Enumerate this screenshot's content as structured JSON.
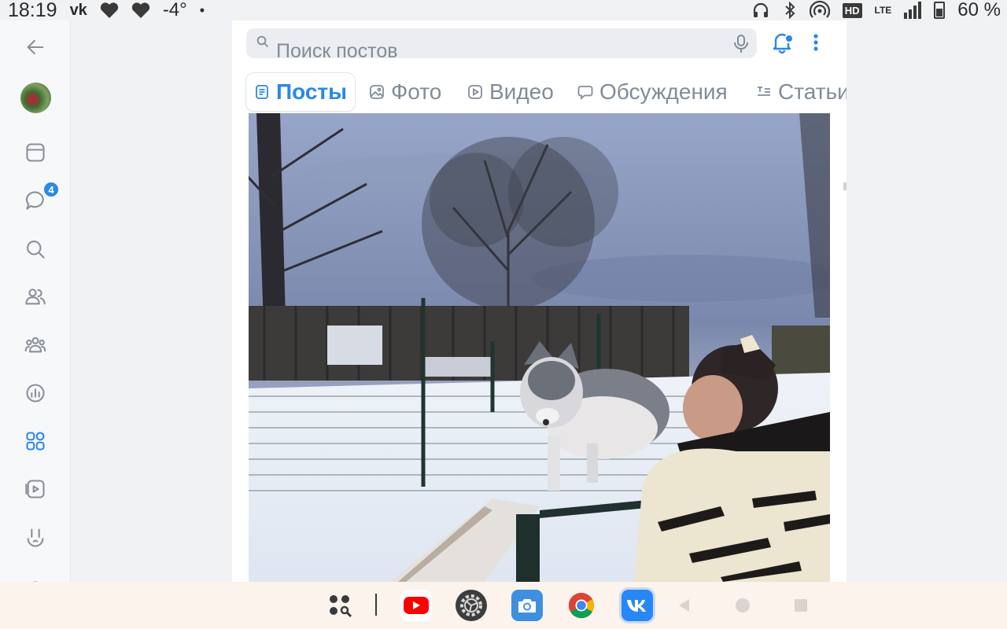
{
  "status_bar": {
    "time": "18:19",
    "vk": "vk",
    "temperature": "-4°",
    "dot": "•",
    "hd": "HD",
    "lte": "LTE",
    "battery": "60 %"
  },
  "sidebar": {
    "messages_badge": "4"
  },
  "search": {
    "placeholder": "Поиск постов"
  },
  "tabs": [
    {
      "label": "Посты",
      "icon": "document-icon",
      "active": true
    },
    {
      "label": "Фото",
      "icon": "image-icon",
      "active": false
    },
    {
      "label": "Видео",
      "icon": "play-icon",
      "active": false
    },
    {
      "label": "Обсуждения",
      "icon": "chat-icon",
      "active": false
    },
    {
      "label": "Статьи",
      "icon": "article-icon",
      "active": false
    }
  ],
  "dock": {
    "apps": [
      "app-drawer",
      "youtube",
      "settings",
      "camera",
      "chrome",
      "vk"
    ]
  },
  "colors": {
    "accent": "#2a88e8",
    "muted": "#818c99"
  }
}
